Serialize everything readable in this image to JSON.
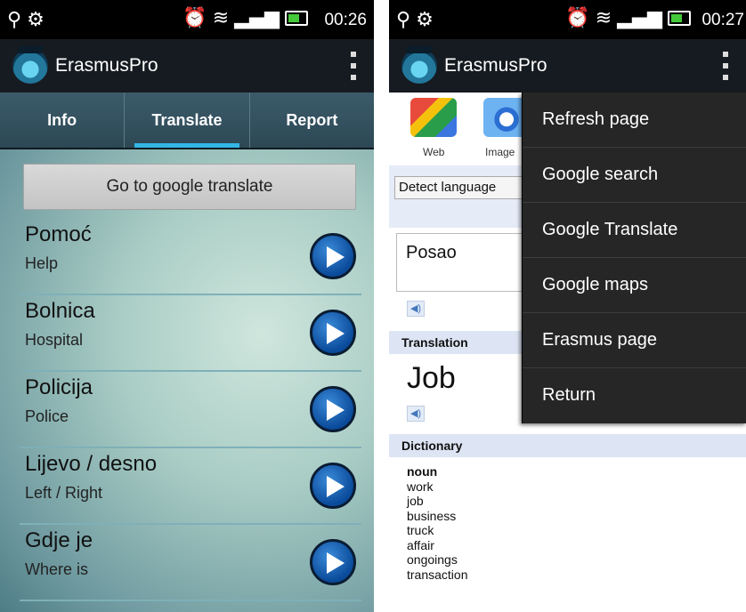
{
  "status_left": {
    "time": "00:26"
  },
  "status_right": {
    "time": "00:27"
  },
  "app": {
    "title": "ErasmusPro"
  },
  "tabs": [
    {
      "label": "Info"
    },
    {
      "label": "Translate",
      "active": true
    },
    {
      "label": "Report"
    }
  ],
  "translate": {
    "button_label": "Go to google translate",
    "phrases": [
      {
        "word": "Pomoć",
        "translation": "Help"
      },
      {
        "word": "Bolnica",
        "translation": "Hospital"
      },
      {
        "word": "Policija",
        "translation": "Police"
      },
      {
        "word": "Lijevo / desno",
        "translation": "Left / Right"
      },
      {
        "word": "Gdje je",
        "translation": "Where is"
      }
    ]
  },
  "browser": {
    "icons": [
      {
        "label": "Web"
      },
      {
        "label": "Image"
      }
    ],
    "detect_language": "Detect language",
    "source_text": "Posao",
    "translation_header": "Translation",
    "translation_text": "Job",
    "dictionary_header": "Dictionary",
    "dictionary_pos": "noun",
    "dictionary_words": [
      "work",
      "job",
      "business",
      "truck",
      "affair",
      "ongoings",
      "transaction"
    ]
  },
  "menu": {
    "items": [
      {
        "label": "Refresh page"
      },
      {
        "label": "Google search"
      },
      {
        "label": "Google Translate"
      },
      {
        "label": "Google maps"
      },
      {
        "label": "Erasmus page"
      },
      {
        "label": "Return"
      }
    ]
  },
  "colors": {
    "accent": "#33b5e5",
    "action_bar": "#161b21",
    "tab_bar": "#3b5b6a",
    "menu_bg": "#262626"
  }
}
